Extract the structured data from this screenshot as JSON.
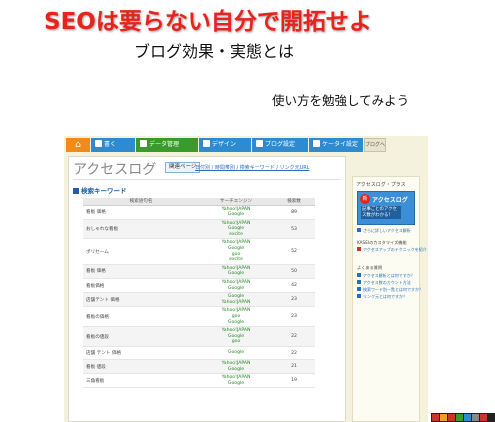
{
  "headline": "SEOは要らない自分で開拓せよ",
  "subtitle": "ブログ効果・実態とは",
  "tagline": "使い方を勉強してみよう",
  "nav": {
    "items": [
      {
        "label": "書く"
      },
      {
        "label": "データ管理"
      },
      {
        "label": "デザイン"
      },
      {
        "label": "ブログ設定"
      },
      {
        "label": "ケータイ設定"
      }
    ],
    "avatar_label": "ブログへ"
  },
  "main": {
    "title": "アクセスログ",
    "related_tab": "関連ページ",
    "breadcrumb": "日付別 / 時間帯別 / 検索キーワード / リンク元URL",
    "section": "検索キーワード",
    "columns": [
      "検索語句名",
      "サーチエンジン",
      "検索数"
    ],
    "rows": [
      {
        "kw": "看板 価格",
        "engines": "Yahoo!JAPAN\nGoogle",
        "count": "89"
      },
      {
        "kw": "おしゃれな看板",
        "engines": "Yahoo!JAPAN\nGoogle\nexcite",
        "count": "53"
      },
      {
        "kw": "ポリセーム",
        "engines": "Yahoo!JAPAN\nGoogle\ngoo\nexcite",
        "count": "52"
      },
      {
        "kw": "看板 価格",
        "engines": "Yahoo!JAPAN\nGoogle",
        "count": "50"
      },
      {
        "kw": "看板価格",
        "engines": "Yahoo!JAPAN\nGoogle",
        "count": "42"
      },
      {
        "kw": "店舗テント 価格",
        "engines": "Google\nYahoo!JAPAN",
        "count": "23"
      },
      {
        "kw": "看板の価格",
        "engines": "Yahoo!JAPAN\ngoo\nGoogle",
        "count": "23"
      },
      {
        "kw": "看板の値段",
        "engines": "Yahoo!JAPAN\nGoogle\ngoo",
        "count": "22"
      },
      {
        "kw": "店舗 テント 価格",
        "engines": "Google",
        "count": "22"
      },
      {
        "kw": "看板 値段",
        "engines": "Yahoo!JAPAN\nGoogle",
        "count": "21"
      },
      {
        "kw": "三角看板",
        "engines": "Yahoo!JAPAN\nGoogle",
        "count": "19"
      }
    ]
  },
  "side": {
    "title": "アクセスログ・プラス",
    "promo_new": "新",
    "promo_name": "アクセスログ",
    "promo_body": "記事ごとのアクセス数がわかる！",
    "promo_link": "さらに詳しいアクセス解析",
    "customize": "KASEIのカスタマイズ機能",
    "customize_link": "アクセスアップのテクニックを紹介",
    "faq_title": "よくある質問",
    "faq": [
      "アクセス解析とは何ですか？",
      "アクセス数のカウント方法",
      "検索ワード別一覧とは何ですか？",
      "リンク元とは何ですか？"
    ]
  },
  "colors": {
    "headline": "#e8231d",
    "nav_blue": "#2e8bd0",
    "nav_green": "#3a9a2b",
    "nav_home": "#f08a1c",
    "link": "#2a6ec0",
    "engine_text": "#2a8a2a"
  }
}
